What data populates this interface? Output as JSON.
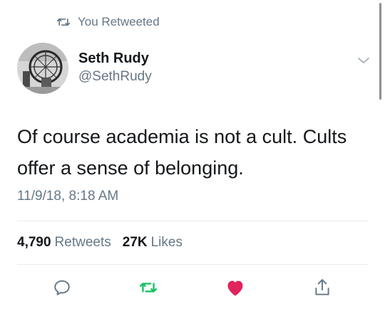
{
  "colors": {
    "secondary_text": "#657786",
    "primary_text": "#14171a",
    "retweet_active": "#17bf63",
    "like_active": "#e0245e",
    "divider": "#e6ecf0"
  },
  "retweet_context": {
    "icon": "retweet-icon",
    "label": "You Retweeted"
  },
  "author": {
    "avatar": "avatar",
    "display_name": "Seth Rudy",
    "handle": "@SethRudy"
  },
  "tweet": {
    "text": "Of course academia is not a cult. Cults offer a sense of belonging.",
    "timestamp": "11/9/18, 8:18 AM"
  },
  "stats": {
    "retweets_count": "4,790",
    "retweets_label": "Retweets",
    "likes_count": "27K",
    "likes_label": "Likes"
  },
  "actions": [
    {
      "icon": "reply-icon"
    },
    {
      "icon": "retweet-icon",
      "active": true
    },
    {
      "icon": "heart-icon",
      "active": true
    },
    {
      "icon": "share-icon"
    }
  ]
}
